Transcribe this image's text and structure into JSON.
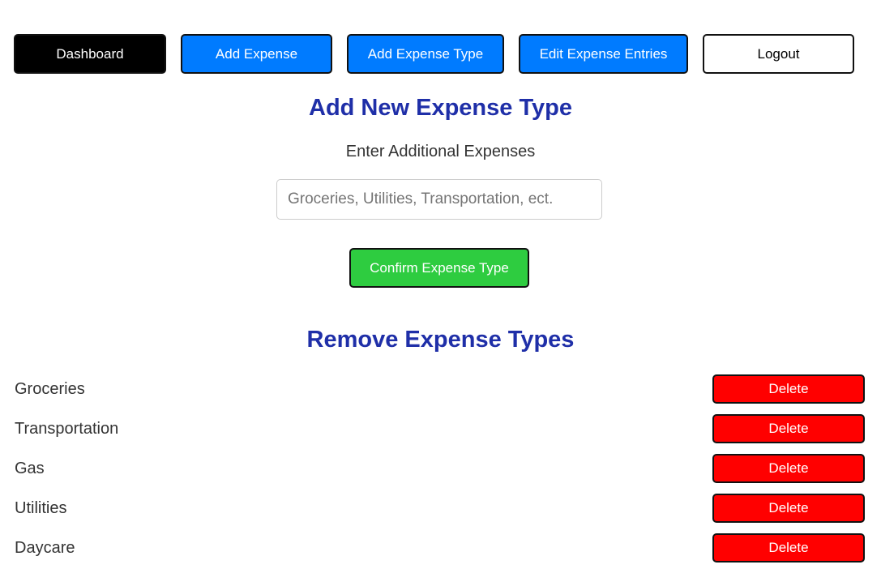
{
  "nav": {
    "dashboard": "Dashboard",
    "add_expense": "Add Expense",
    "add_expense_type": "Add Expense Type",
    "edit_expense_entries": "Edit Expense Entries",
    "logout": "Logout"
  },
  "add_section": {
    "title": "Add New Expense Type",
    "subtitle": "Enter Additional Expenses",
    "input_value": "",
    "input_placeholder": "Groceries, Utilities, Transportation, ect.",
    "confirm_label": "Confirm Expense Type"
  },
  "remove_section": {
    "title": "Remove Expense Types",
    "items": [
      {
        "label": "Groceries",
        "button": "Delete"
      },
      {
        "label": "Transportation",
        "button": "Delete"
      },
      {
        "label": "Gas",
        "button": "Delete"
      },
      {
        "label": "Utilities",
        "button": "Delete"
      },
      {
        "label": "Daycare",
        "button": "Delete"
      }
    ]
  },
  "colors": {
    "nav_primary": "#007bff",
    "nav_active": "#000000",
    "heading": "#1f2fa8",
    "confirm": "#2ecc40",
    "delete": "#ff0000"
  }
}
